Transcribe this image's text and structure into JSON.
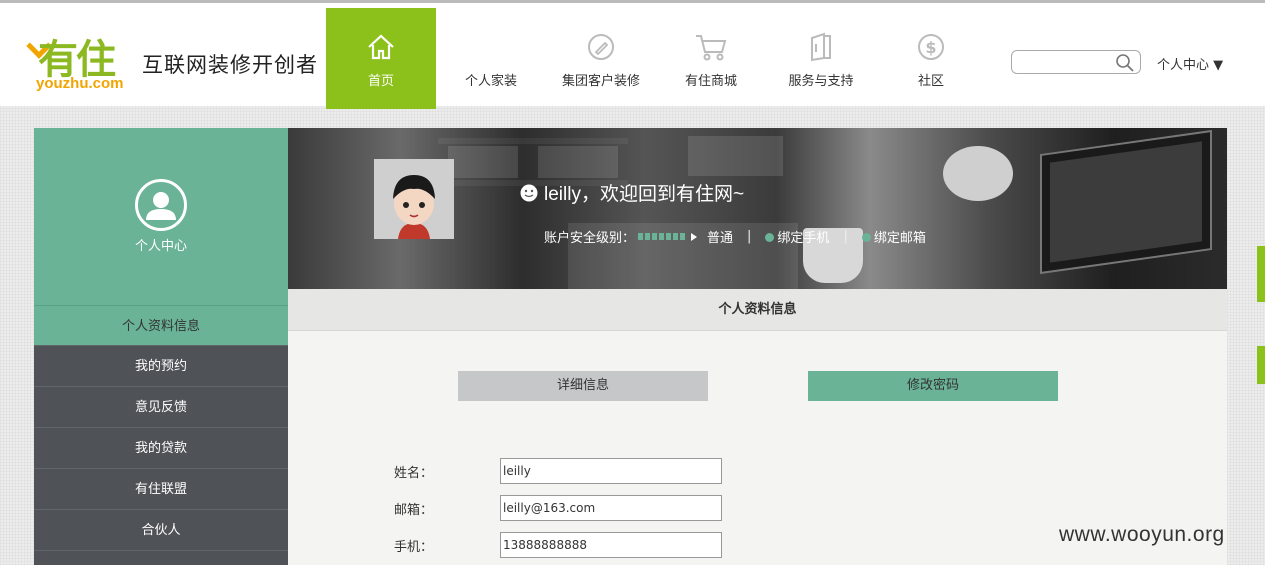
{
  "brand": {
    "logo_cn": "有住",
    "logo_en": "youzhu.com",
    "slogan": "互联网装修开创者"
  },
  "nav": {
    "items": [
      {
        "label": "首页",
        "icon": "home-icon"
      },
      {
        "label": "个人家装",
        "icon": ""
      },
      {
        "label": "集团客户装修",
        "icon": "pencil-icon"
      },
      {
        "label": "有住商城",
        "icon": "cart-icon"
      },
      {
        "label": "服务与支持",
        "icon": "document-icon"
      },
      {
        "label": "社区",
        "icon": "dollar-icon"
      }
    ],
    "search_placeholder": "",
    "user_menu": "个人中心 ▼"
  },
  "sidebar": {
    "title": "个人中心",
    "items": [
      {
        "label": "个人资料信息"
      },
      {
        "label": "我的预约"
      },
      {
        "label": "意见反馈"
      },
      {
        "label": "我的贷款"
      },
      {
        "label": "有住联盟"
      },
      {
        "label": "合伙人"
      }
    ]
  },
  "banner": {
    "welcome": "leilly，欢迎回到有住网~",
    "security_label": "账户安全级别：",
    "security_level": "普通",
    "bind_phone": "绑定手机",
    "bind_email": "绑定邮箱",
    "separator": "|"
  },
  "section": {
    "title": "个人资料信息"
  },
  "tabs": {
    "detail": "详细信息",
    "password": "修改密码"
  },
  "form": {
    "name_label": "姓名：",
    "name_value": "leilly",
    "email_label": "邮箱：",
    "email_value": "leilly@163.com",
    "phone_label": "手机：",
    "phone_value": "13888888888"
  },
  "watermark": "www.wooyun.org",
  "colors": {
    "brand_green": "#8cc11b",
    "teal": "#6ab397",
    "sidebar_dark": "#4f5357",
    "logo_orange": "#f0a500"
  }
}
